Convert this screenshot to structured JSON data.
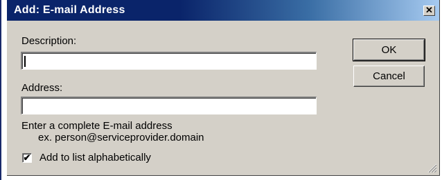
{
  "dialog": {
    "title": "Add: E-mail Address",
    "close_glyph": "✕",
    "close_icon": "close-icon"
  },
  "form": {
    "description_label": "Description:",
    "description_value": "",
    "address_label": "Address:",
    "address_value": "",
    "hint_line1": "Enter a complete E-mail address",
    "hint_line2": "ex. person@serviceprovider.domain",
    "checkbox_label": "Add to list alphabetically",
    "checkbox_checked": true,
    "checkbox_glyph": "✔"
  },
  "buttons": {
    "ok_label": "OK",
    "cancel_label": "Cancel"
  },
  "colors": {
    "titlebar_start": "#0a246a",
    "titlebar_end": "#a6caf0",
    "dialog_face": "#d4d0c8"
  }
}
